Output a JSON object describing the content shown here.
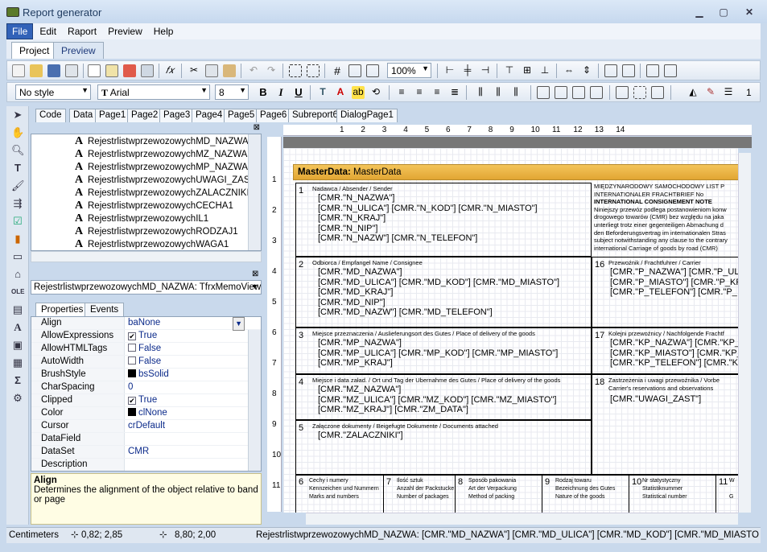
{
  "window": {
    "title": "Report generator"
  },
  "menu": [
    "File",
    "Edit",
    "Raport",
    "Preview",
    "Help"
  ],
  "top_tabs": [
    "Project",
    "Preview"
  ],
  "toolbar": {
    "zoom": "100%",
    "style": "No style",
    "font": "Arial",
    "size": "8",
    "extra": "1"
  },
  "design_tabs": [
    "Code",
    "Data",
    "Page1",
    "Page2",
    "Page3",
    "Page4",
    "Page5",
    "Page6",
    "Subreport6",
    "DialogPage1"
  ],
  "tree": [
    "RejestrlistwprzewozowychMD_NAZWA",
    "RejestrlistwprzewozowychMZ_NAZWA",
    "RejestrlistwprzewozowychMP_NAZWA",
    "RejestrlistwprzewozowychUWAGI_ZAST",
    "RejestrlistwprzewozowychZALACZNIKI",
    "RejestrlistwprzewozowychCECHA1",
    "RejestrlistwprzewozowychIL1",
    "RejestrlistwprzewozowychRODZAJ1",
    "RejestrlistwprzewozowychWAGA1"
  ],
  "object_combo": "RejestrlistwprzewozowychMD_NAZWA: TfrxMemoView",
  "prop_tabs": [
    "Properties",
    "Events"
  ],
  "props": [
    {
      "n": "Align",
      "v": "baNone"
    },
    {
      "n": "AllowExpressions",
      "v": "True",
      "cb": "✔"
    },
    {
      "n": "AllowHTMLTags",
      "v": "False",
      "cb": ""
    },
    {
      "n": "AutoWidth",
      "v": "False",
      "cb": ""
    },
    {
      "n": "BrushStyle",
      "v": "bsSolid",
      "sw": "#000000"
    },
    {
      "n": "CharSpacing",
      "v": "0"
    },
    {
      "n": "Clipped",
      "v": "True",
      "cb": "✔"
    },
    {
      "n": "Color",
      "v": "clNone",
      "sw": "#000000"
    },
    {
      "n": "Cursor",
      "v": "crDefault"
    },
    {
      "n": "DataField",
      "v": ""
    },
    {
      "n": "DataSet",
      "v": "CMR"
    },
    {
      "n": "Description",
      "v": ""
    }
  ],
  "desc": {
    "title": "Align",
    "text": "Determines the alignment of the object relative to band or page"
  },
  "ruler": [
    "1",
    "2",
    "3",
    "4",
    "5",
    "6",
    "7",
    "8",
    "9",
    "10",
    "11",
    "12",
    "13",
    "14"
  ],
  "vruler": [
    "1",
    "2",
    "3",
    "4",
    "5",
    "6",
    "7",
    "8",
    "9",
    "10",
    "11"
  ],
  "band": {
    "label": "MasterData:",
    "name": "MasterData"
  },
  "cells": {
    "c1": {
      "num": "1",
      "cap": "Nadawca / Absender / Sender",
      "fields": [
        "[CMR.\"N_NAZWA\"]",
        "[CMR.\"N_ULICA\"] [CMR.\"N_KOD\"] [CMR.\"N_MIASTO\"]",
        "[CMR.\"N_KRAJ\"]",
        "[CMR.\"N_NIP\"]",
        "[CMR.\"N_NAZW\"] [CMR.\"N_TELEFON\"]"
      ]
    },
    "c2": {
      "num": "2",
      "cap": "Odbiorca / Empfangel Name / Consignee",
      "fields": [
        "[CMR.\"MD_NAZWA\"]",
        "[CMR.\"MD_ULICA\"] [CMR.\"MD_KOD\"] [CMR.\"MD_MIASTO\"]",
        "[CMR.\"MD_KRAJ\"]",
        "[CMR.\"MD_NIP\"]",
        "[CMR.\"MD_NAZW\"] [CMR.\"MD_TELEFON\"]"
      ]
    },
    "c3": {
      "num": "3",
      "cap": "Miejsce przeznaczenia / Auslieferungsort des Gutes / Place of delivery of the goods",
      "fields": [
        "[CMR.\"MP_NAZWA\"]",
        "[CMR.\"MP_ULICA\"] [CMR.\"MP_KOD\"] [CMR.\"MP_MIASTO\"]",
        "[CMR.\"MP_KRAJ\"]"
      ]
    },
    "c4": {
      "num": "4",
      "cap": "Miejsce i data załad. / Ort und Tag der Ubernahme des Gutes / Place of delivery of the goods",
      "fields": [
        "[CMR.\"MZ_NAZWA\"]",
        "[CMR.\"MZ_ULICA\"] [CMR.\"MZ_KOD\"] [CMR.\"MZ_MIASTO\"]",
        "[CMR.\"MZ_KRAJ\"] [CMR.\"ZM_DATA\"]"
      ]
    },
    "c5": {
      "num": "5",
      "cap": "Załączone dokumenty / Beigefugte Dokumente / Documents attached",
      "fields": [
        "[CMR.\"ZALACZNIKI\"]"
      ]
    },
    "c16": {
      "num": "16",
      "cap": "Przewoźnik / Frachtfuhrer / Carrier",
      "fields": [
        "[CMR.\"P_NAZWA\"] [CMR.\"P_UL",
        "[CMR.\"P_MIASTO\"] [CMR.\"P_KR",
        "[CMR.\"P_TELEFON\"] [CMR.\"P_"
      ]
    },
    "c17": {
      "num": "17",
      "cap": "Kolejni przewoźnicy / Nachfolgende Frachtf",
      "fields": [
        "[CMR.\"KP_NAZWA\"] [CMR.\"KP_",
        "[CMR.\"KP_MIASTO\"] [CMR.\"KP_",
        "[CMR.\"KP_TELEFON\"] [CMR.\"K"
      ]
    },
    "c18": {
      "num": "18",
      "cap": "Zastrzeżenia i uwagi przewoźnika / Vorbe",
      "cap2": "Carrier's reservations and observations",
      "fields": [
        "[CMR.\"UWAGI_ZAST\"]"
      ]
    }
  },
  "notice": [
    "MIĘDZYNARODOWY SAMOCHODOWY LIST P",
    "INTERNATIONALER FRACHTBRIEF No",
    "INTERNATIONAL CONSIGNEMENT NOTE",
    "Niniejszy przewóz podlega postanowieniom konw",
    "drogowego towarów (CMR) bez względu na jaka",
    "unterliegt trotz einer gegenteiligen Abmachung d",
    "den Beforderungsvertrag im internationalen Stras",
    "subject notwithstanding any clause to the contrary",
    "international Carriage of goods by road (CMR)"
  ],
  "bottom_cells": [
    {
      "num": "6",
      "l1": "Cechy i numery",
      "l2": "Kennzeichen und Nummern",
      "l3": "Marks and numbers"
    },
    {
      "num": "7",
      "l1": "Ilość sztuk",
      "l2": "Anzahl der Packstucke",
      "l3": "Number of packages"
    },
    {
      "num": "8",
      "l1": "Sposób pakowania",
      "l2": "Art der Verpackung",
      "l3": "Method of packing"
    },
    {
      "num": "9",
      "l1": "Rodzaj towaru",
      "l2": "Bezeichnung des Gutes",
      "l3": "Nature of the goods"
    },
    {
      "num": "10",
      "l1": "Nr statystyczny",
      "l2": "Statistiknummer",
      "l3": "Statistical number"
    },
    {
      "num": "11",
      "l1": "W",
      "l2": "",
      "l3": "G"
    }
  ],
  "status": {
    "unit": "Centimeters",
    "pos": "0,82; 2,85",
    "size": "8,80; 2,00",
    "text": "RejestrlistwprzewozowychMD_NAZWA: [CMR.\"MD_NAZWA\"]  [CMR.\"MD_ULICA\"]  [CMR.\"MD_KOD\"]  [CMR.\"MD_MIASTO\"]  [CMR."
  },
  "colors": {
    "band": "#e2a633",
    "accent": "#3262b8"
  }
}
